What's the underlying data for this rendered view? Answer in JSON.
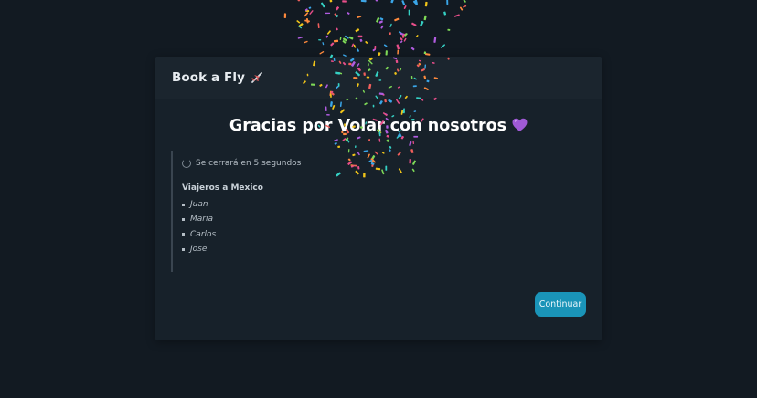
{
  "header": {
    "brand": "Book a Fly",
    "brand_icon": "airplane-icon"
  },
  "main": {
    "title": "Gracias por Volar con nosotros",
    "title_icon": "purple-heart-icon",
    "countdown_text": "Se cerrará en 5 segundos",
    "travelers_title": "Viajeros a Mexico",
    "travelers": [
      "Juan",
      "Maria",
      "Carlos",
      "Jose"
    ],
    "continue_label": "Continuar"
  },
  "colors": {
    "background": "#121a22",
    "card": "#17212a",
    "header": "#1b252e",
    "accent": "#1a94b8",
    "heart": "#a05ad6"
  },
  "confetti_colors": [
    "#f0c419",
    "#e84e8a",
    "#3aa6e8",
    "#7ed957",
    "#b15ce0",
    "#ff8a3d",
    "#35d0c4",
    "#f25f5c"
  ]
}
